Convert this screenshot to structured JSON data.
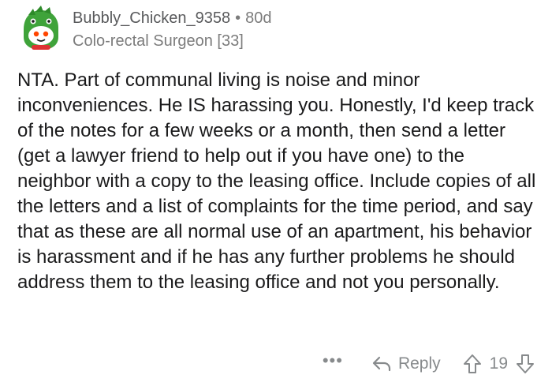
{
  "comment": {
    "author": "Bubbly_Chicken_9358",
    "separator": "•",
    "age": "80d",
    "flair": "Colo-rectal Surgeon [33]",
    "body": "NTA.  Part of communal living is noise and minor inconveniences.  He IS harassing you.  Honestly, I'd keep track of the notes for a few weeks or a month, then send a letter (get a lawyer friend to help out if you have one) to the neighbor with a copy to the leasing office.  Include copies of all the letters and a list of complaints for the time period, and say that as these are all normal use of an apartment, his behavior is harassment and if he has any further problems he should address them to the leasing office and not you personally."
  },
  "actions": {
    "more_label": "•••",
    "reply_label": "Reply",
    "score": "19"
  },
  "icons": {
    "avatar": "snoo-avatar-icon",
    "reply": "reply-arrow-icon",
    "upvote": "upvote-arrow-icon",
    "downvote": "downvote-arrow-icon"
  },
  "colors": {
    "text": "#1a1a1b",
    "meta": "#7c7c7c",
    "action": "#878a8c",
    "avatar_green": "#46a508"
  }
}
